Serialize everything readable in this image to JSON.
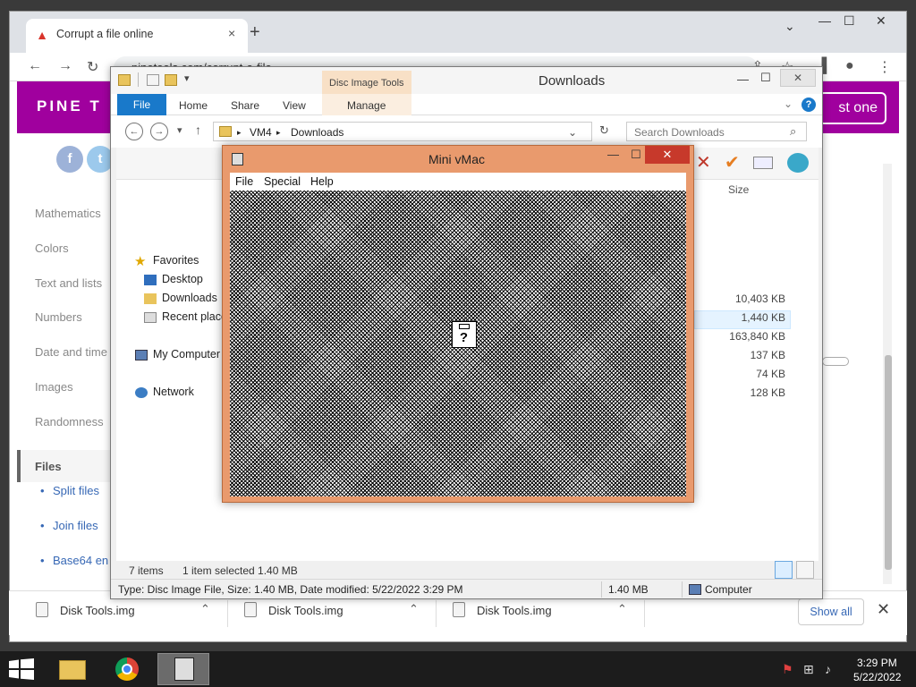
{
  "browser": {
    "tab_title": "Corrupt a file online",
    "tab_close": "×",
    "new_tab": "+",
    "url": "pinetools.com/corrupt-a-file",
    "window_controls": {
      "minimize": "—",
      "maximize": "☐",
      "close": "✕",
      "dropdown": "⌄"
    },
    "nav": {
      "back": "←",
      "forward": "→",
      "reload": "↻"
    },
    "toolbar_icons": {
      "share": "⇪",
      "bookmark": "☆",
      "sidebar": "▐",
      "profile": "●",
      "menu": "⋮"
    }
  },
  "pinetools": {
    "logo": "PINE T",
    "header_button": "st one",
    "social": {
      "facebook": "f",
      "twitter": "t"
    },
    "sidebar": {
      "items": [
        "Mathematics",
        "Colors",
        "Text and lists",
        "Numbers",
        "Date and time",
        "Images",
        "Randomness"
      ],
      "active": "Files",
      "subitems": [
        "Split files",
        "Join files",
        "Base64 en"
      ]
    }
  },
  "downloads_shelf": {
    "items": [
      "Disk Tools.img",
      "Disk Tools.img",
      "Disk Tools.img"
    ],
    "caret": "⌃",
    "show_all": "Show all",
    "close": "✕"
  },
  "explorer": {
    "title": "Downloads",
    "context_tab_group": "Disc Image Tools",
    "ribbon_tabs": {
      "file": "File",
      "home": "Home",
      "share": "Share",
      "view": "View",
      "manage": "Manage"
    },
    "ribbon_icons": {
      "expand": "⌄",
      "help": "?"
    },
    "window_controls": {
      "minimize": "—",
      "maximize": "☐",
      "close": "✕"
    },
    "address": {
      "root": "VM4",
      "current": "Downloads",
      "back": "←",
      "forward": "→",
      "recent": "▾",
      "up": "↑",
      "separator": "▸",
      "dropdown": "⌄",
      "refresh": "↻"
    },
    "search_placeholder": "Search Downloads",
    "search_icon": "⌕",
    "nav_pane": {
      "favorites": "Favorites",
      "favorite_items": [
        "Desktop",
        "Downloads",
        "Recent place"
      ],
      "computer": "My Computer",
      "network": "Network"
    },
    "columns": {
      "size": "Size"
    },
    "sizes": [
      "10,403 KB",
      "1,440 KB",
      "163,840 KB",
      "137 KB",
      "74 KB",
      "128 KB"
    ],
    "status": {
      "items": "7 items",
      "selected": "1 item selected  1.40 MB"
    },
    "details": {
      "info": "Type: Disc Image File, Size: 1.40 MB, Date modified: 5/22/2022 3:29 PM",
      "size": "1.40 MB",
      "location": "Computer"
    },
    "toolbar_icons": {
      "delete": "✕",
      "check": "✔"
    }
  },
  "vmac": {
    "title": "Mini vMac",
    "window_controls": {
      "minimize": "—",
      "maximize": "☐",
      "close": "✕"
    },
    "menu": [
      "File",
      "Special",
      "Help"
    ],
    "disk_icon_glyph": "?"
  },
  "taskbar": {
    "time": "3:29 PM",
    "date": "5/22/2022",
    "tray": {
      "flag": "⚑",
      "network": "⊞",
      "volume": "♪"
    }
  },
  "colors": {
    "pinetools_header": "#a0009e",
    "file_tab": "#1979ca",
    "vmac_frame": "#e99a6d",
    "vmac_close": "#c7392b"
  }
}
